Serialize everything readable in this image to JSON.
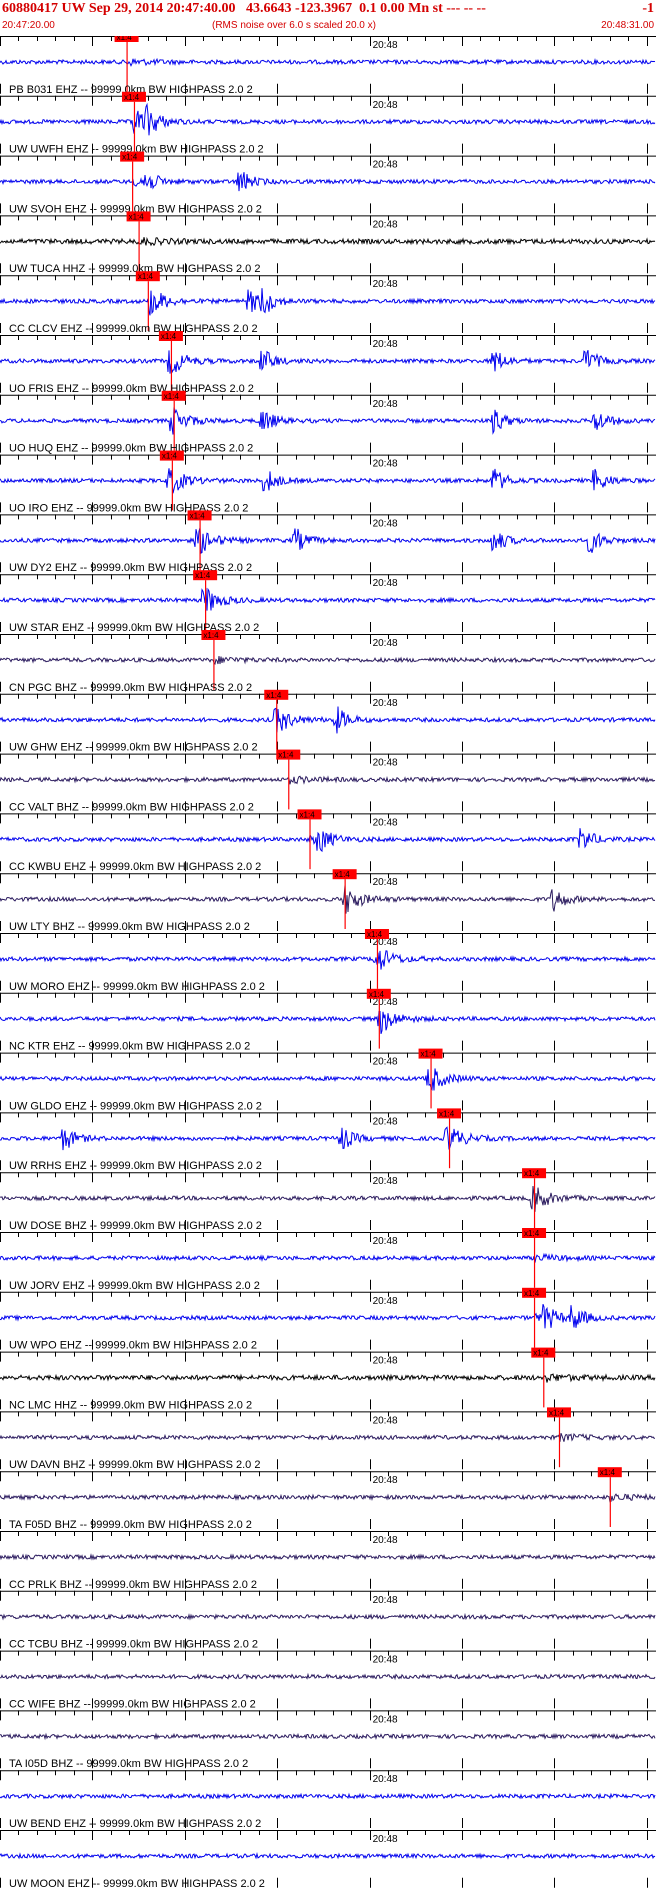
{
  "header": {
    "title": "60880417 UW Sep 29, 2014 20:47:40.00   43.6643 -123.3967  0.1 0.00 Mn st --- -- --",
    "title_right": "-1",
    "start_time": "20:47:20.00",
    "noise_note": "(RMS noise over 6.0 s scaled 20.0 x)",
    "end_time": "20:48:31.00"
  },
  "colors": {
    "header_text": "#d40000",
    "pick_box": "#ff0000",
    "blue_trace": "#0000ee",
    "dark_trace": "#2a1a5e",
    "black_trace": "#000000"
  },
  "chart_data": {
    "type": "seismogram_record_section",
    "time_start": "20:47:20.00",
    "time_end": "20:48:31.00",
    "tick_label": "20:48",
    "pick_label": "x1:4",
    "station_label_suffix": "-- 99999.0km BW  HIGHPASS  2.0  2",
    "traces": [
      {
        "station": "PB B031 EHZ",
        "color": "blue",
        "pick_time_s": 13.7,
        "events_s": []
      },
      {
        "station": "UW UWFH EHZ",
        "color": "blue",
        "pick_time_s": 14.5,
        "events_s": [
          14.5,
          16.0
        ]
      },
      {
        "station": "UW SVOH EHZ",
        "color": "blue",
        "pick_time_s": 14.3,
        "events_s": [
          15.5,
          26.0
        ]
      },
      {
        "station": "UW TUCA HHZ",
        "color": "black",
        "pick_time_s": 15.0,
        "events_s": []
      },
      {
        "station": "CC CLCV EHZ",
        "color": "blue",
        "pick_time_s": 16.0,
        "events_s": [
          16.5,
          27.0,
          28.5
        ]
      },
      {
        "station": "UO FRIS EHZ",
        "color": "blue",
        "pick_time_s": 18.5,
        "events_s": [
          18.5,
          28.5,
          53.5,
          63.5
        ]
      },
      {
        "station": "UO HUQ EHZ",
        "color": "blue",
        "pick_time_s": 18.8,
        "events_s": [
          18.7,
          28.5,
          53.5,
          64.5
        ]
      },
      {
        "station": "UO IRO EHZ",
        "color": "blue",
        "pick_time_s": 18.6,
        "events_s": [
          18.4,
          28.8,
          53.5,
          64.5
        ]
      },
      {
        "station": "UW DY2 EHZ",
        "color": "blue",
        "pick_time_s": 21.6,
        "events_s": [
          21.5,
          32.0,
          53.5,
          64.0
        ]
      },
      {
        "station": "UW STAR EHZ",
        "color": "blue",
        "pick_time_s": 22.2,
        "events_s": [
          22.2
        ]
      },
      {
        "station": "CN PGC BHZ",
        "color": "dark",
        "pick_time_s": 23.1,
        "events_s": []
      },
      {
        "station": "UW GHW EHZ",
        "color": "blue",
        "pick_time_s": 29.9,
        "events_s": [
          30.0,
          36.5
        ]
      },
      {
        "station": "CC VALT BHZ",
        "color": "dark",
        "pick_time_s": 31.2,
        "events_s": []
      },
      {
        "station": "CC KWBU EHZ",
        "color": "blue",
        "pick_time_s": 33.5,
        "events_s": [
          34.5,
          63.0
        ]
      },
      {
        "station": "UW LTY BHZ",
        "color": "dark",
        "pick_time_s": 37.3,
        "events_s": [
          37.5,
          60.0
        ]
      },
      {
        "station": "UW MORO EHZ",
        "color": "blue",
        "pick_time_s": 40.8,
        "events_s": [
          40.8
        ]
      },
      {
        "station": "NC KTR EHZ",
        "color": "blue",
        "pick_time_s": 41.0,
        "events_s": [
          41.3
        ]
      },
      {
        "station": "UW GLDO EHZ",
        "color": "blue",
        "pick_time_s": 46.6,
        "events_s": [
          46.5
        ]
      },
      {
        "station": "UW RRHS EHZ",
        "color": "blue",
        "pick_time_s": 48.6,
        "events_s": [
          7.0,
          37.0,
          48.5
        ]
      },
      {
        "station": "UW DOSE BHZ",
        "color": "dark",
        "pick_time_s": 57.8,
        "events_s": [
          57.8
        ]
      },
      {
        "station": "UW JORV EHZ",
        "color": "blue",
        "pick_time_s": 57.8,
        "events_s": []
      },
      {
        "station": "UW WPO EHZ",
        "color": "blue",
        "pick_time_s": 57.8,
        "events_s": [
          59.0,
          62.0
        ]
      },
      {
        "station": "NC LMC HHZ",
        "color": "black",
        "pick_time_s": 58.8,
        "events_s": []
      },
      {
        "station": "UW DAVN BHZ",
        "color": "dark",
        "pick_time_s": 60.5,
        "events_s": []
      },
      {
        "station": "TA F05D BHZ",
        "color": "dark",
        "pick_time_s": 66.0,
        "events_s": []
      },
      {
        "station": "CC PRLK BHZ",
        "color": "dark",
        "pick_time_s": null,
        "events_s": []
      },
      {
        "station": "CC TCBU BHZ",
        "color": "dark",
        "pick_time_s": null,
        "events_s": []
      },
      {
        "station": "CC WIFE BHZ",
        "color": "dark",
        "pick_time_s": null,
        "events_s": []
      },
      {
        "station": "TA I05D BHZ",
        "color": "dark",
        "pick_time_s": null,
        "events_s": []
      },
      {
        "station": "UW BEND EHZ",
        "color": "blue",
        "pick_time_s": null,
        "events_s": []
      },
      {
        "station": "UW MOON EHZ",
        "color": "blue",
        "pick_time_s": null,
        "events_s": []
      }
    ]
  }
}
